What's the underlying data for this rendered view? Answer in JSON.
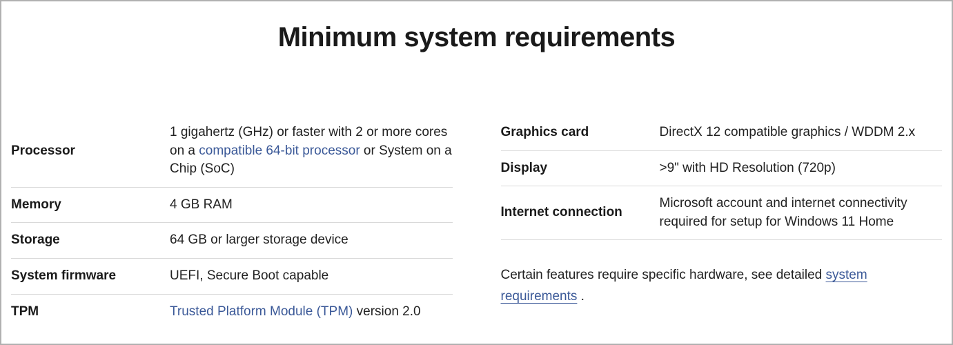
{
  "title": "Minimum system requirements",
  "left": [
    {
      "label": "Processor",
      "value_pre": "1 gigahertz (GHz) or faster with 2 or more cores on a ",
      "link": "compatible 64-bit processor",
      "value_post": " or System on a Chip (SoC)"
    },
    {
      "label": "Memory",
      "value": "4 GB RAM"
    },
    {
      "label": "Storage",
      "value": "64 GB or larger storage device"
    },
    {
      "label": "System firmware",
      "value": "UEFI, Secure Boot capable"
    },
    {
      "label": "TPM",
      "link": "Trusted Platform Module (TPM)",
      "value_post": " version 2.0"
    }
  ],
  "right": [
    {
      "label": "Graphics card",
      "value": "DirectX 12 compatible graphics / WDDM 2.x"
    },
    {
      "label": "Display",
      "value": ">9\" with HD Resolution (720p)"
    },
    {
      "label": "Internet connection",
      "value": "Microsoft account and internet connectivity required for setup for Windows 11 Home"
    }
  ],
  "footnote_pre": "Certain features require specific hardware, see detailed ",
  "footnote_link": "system requirements",
  "footnote_post": " ."
}
